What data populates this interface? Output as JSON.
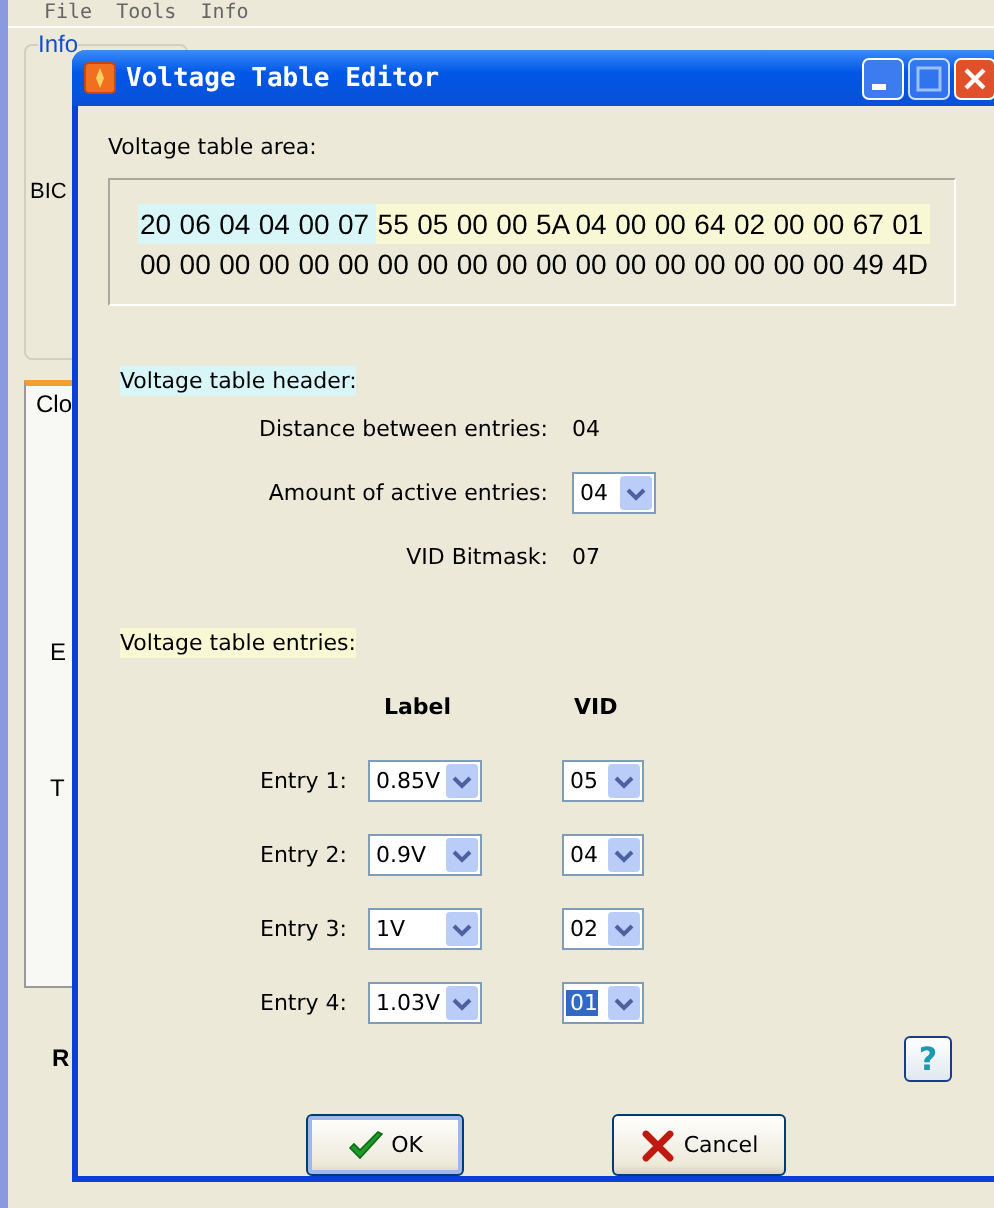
{
  "background_app": {
    "menu": [
      "File",
      "Tools",
      "Info"
    ],
    "group_label": "Info",
    "bios_label": "BIC",
    "tab_label": "Clo",
    "label_e": "E",
    "label_t": "T",
    "label_r": "R"
  },
  "dialog": {
    "title": "Voltage Table Editor",
    "area_label": "Voltage table area:",
    "hex_rows": [
      [
        {
          "text": "20",
          "color": "#d8f6f8"
        },
        {
          "text": "06",
          "color": "#d8f6f8"
        },
        {
          "text": "04",
          "color": "#d8f6f8"
        },
        {
          "text": "04",
          "color": "#d8f6f8"
        },
        {
          "text": "00",
          "color": "#d8f6f8"
        },
        {
          "text": "07",
          "color": "#d8f6f8"
        },
        {
          "text": "55",
          "color": "#f8f8d4"
        },
        {
          "text": "05",
          "color": "#f8f8d4"
        },
        {
          "text": "00",
          "color": "#f8f8d4"
        },
        {
          "text": "00",
          "color": "#f8f8d4"
        },
        {
          "text": "5A",
          "color": "#f8f8d4"
        },
        {
          "text": "04",
          "color": "#f8f8d4"
        },
        {
          "text": "00",
          "color": "#f8f8d4"
        },
        {
          "text": "00",
          "color": "#f8f8d4"
        },
        {
          "text": "64",
          "color": "#f8f8d4"
        },
        {
          "text": "02",
          "color": "#f8f8d4"
        },
        {
          "text": "00",
          "color": "#f8f8d4"
        },
        {
          "text": "00",
          "color": "#f8f8d4"
        },
        {
          "text": "67",
          "color": "#f8f8d4"
        },
        {
          "text": "01",
          "color": "#f8f8d4"
        }
      ],
      [
        {
          "text": "00"
        },
        {
          "text": "00"
        },
        {
          "text": "00"
        },
        {
          "text": "00"
        },
        {
          "text": "00"
        },
        {
          "text": "00"
        },
        {
          "text": "00"
        },
        {
          "text": "00"
        },
        {
          "text": "00"
        },
        {
          "text": "00"
        },
        {
          "text": "00"
        },
        {
          "text": "00"
        },
        {
          "text": "00"
        },
        {
          "text": "00"
        },
        {
          "text": "00"
        },
        {
          "text": "00"
        },
        {
          "text": "00"
        },
        {
          "text": "00"
        },
        {
          "text": "49"
        },
        {
          "text": "4D"
        }
      ]
    ],
    "header_section": {
      "label": "Voltage table header:",
      "color": "#d8f6f8",
      "distance_label": "Distance between entries:",
      "distance_value": "04",
      "active_label": "Amount of active entries:",
      "active_value": "04",
      "bitmask_label": "VID Bitmask:",
      "bitmask_value": "07"
    },
    "entries_section": {
      "label": "Voltage table entries:",
      "color": "#f8f8d4",
      "columns": [
        "Label",
        "VID"
      ],
      "entries": [
        {
          "name": "Entry 1:",
          "label_value": "0.85V",
          "vid": "05",
          "vid_focused": false
        },
        {
          "name": "Entry 2:",
          "label_value": "0.9V",
          "vid": "04",
          "vid_focused": false
        },
        {
          "name": "Entry 3:",
          "label_value": "1V",
          "vid": "02",
          "vid_focused": false
        },
        {
          "name": "Entry 4:",
          "label_value": "1.03V",
          "vid": "01",
          "vid_focused": true
        }
      ]
    },
    "help_button": "?",
    "buttons": [
      {
        "kind": "ok",
        "label": "OK"
      },
      {
        "kind": "cancel",
        "label": "Cancel"
      }
    ]
  }
}
